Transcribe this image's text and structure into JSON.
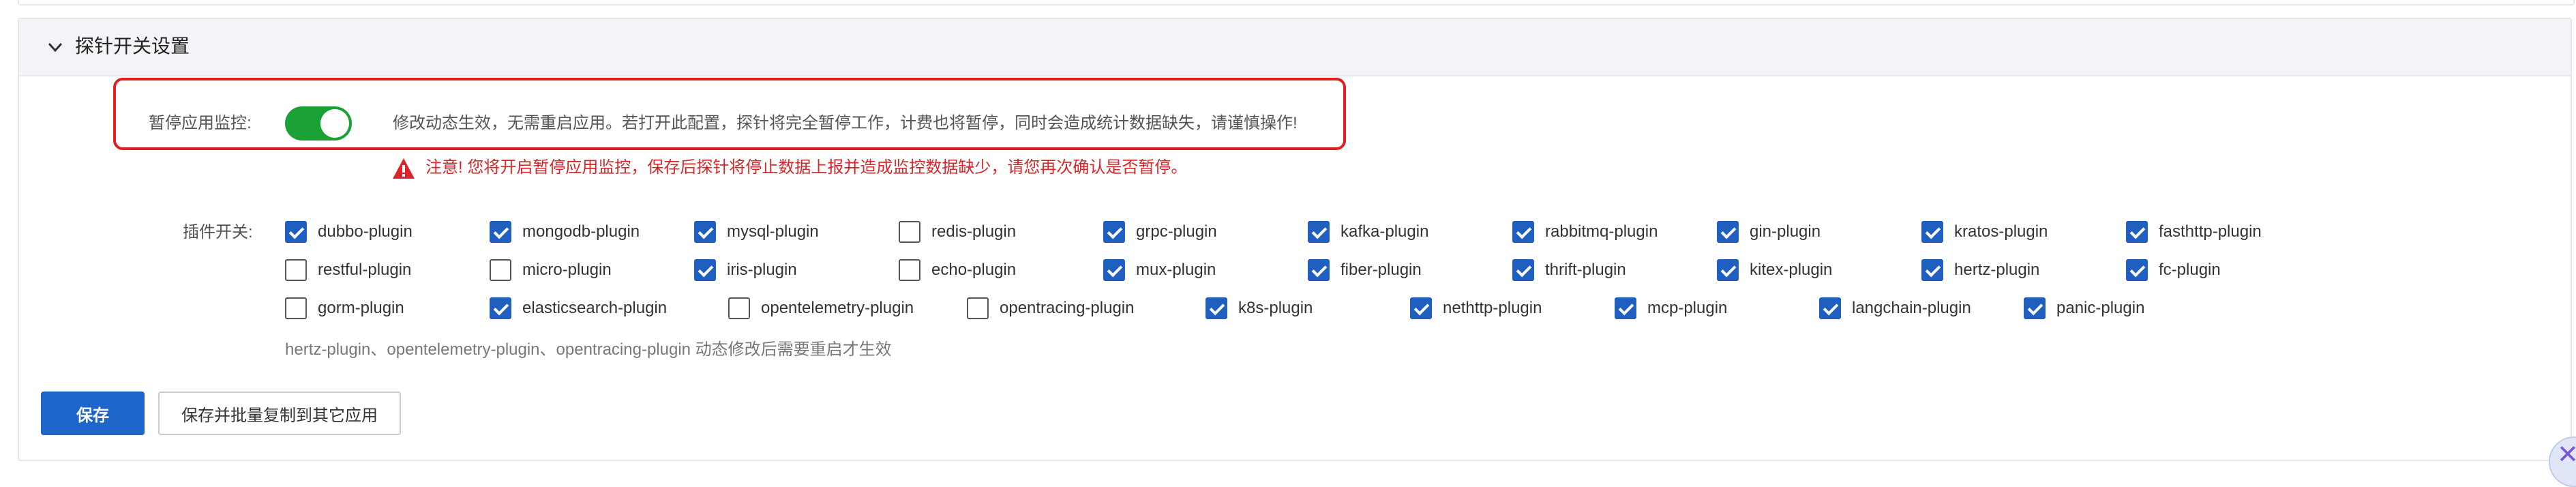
{
  "section": {
    "title": "探针开关设置",
    "expanded": true
  },
  "pause": {
    "label": "暂停应用监控:",
    "enabled": true,
    "hint": "修改动态生效，无需重启应用。若打开此配置，探针将完全暂停工作，计费也将暂停，同时会造成统计数据缺失，请谨慎操作!",
    "warning": "注意! 您将开启暂停应用监控，保存后探针将停止数据上报并造成监控数据缺少，请您再次确认是否暂停。"
  },
  "plugins": {
    "label": "插件开关:",
    "rows": [
      [
        {
          "name": "dubbo-plugin",
          "checked": true
        },
        {
          "name": "mongodb-plugin",
          "checked": true
        },
        {
          "name": "mysql-plugin",
          "checked": true
        },
        {
          "name": "redis-plugin",
          "checked": false
        },
        {
          "name": "grpc-plugin",
          "checked": true
        },
        {
          "name": "kafka-plugin",
          "checked": true
        },
        {
          "name": "rabbitmq-plugin",
          "checked": true
        },
        {
          "name": "gin-plugin",
          "checked": true
        },
        {
          "name": "kratos-plugin",
          "checked": true
        },
        {
          "name": "fasthttp-plugin",
          "checked": true
        }
      ],
      [
        {
          "name": "restful-plugin",
          "checked": false
        },
        {
          "name": "micro-plugin",
          "checked": false
        },
        {
          "name": "iris-plugin",
          "checked": true
        },
        {
          "name": "echo-plugin",
          "checked": false
        },
        {
          "name": "mux-plugin",
          "checked": true
        },
        {
          "name": "fiber-plugin",
          "checked": true
        },
        {
          "name": "thrift-plugin",
          "checked": true
        },
        {
          "name": "kitex-plugin",
          "checked": true
        },
        {
          "name": "hertz-plugin",
          "checked": true
        },
        {
          "name": "fc-plugin",
          "checked": true
        }
      ],
      [
        {
          "name": "gorm-plugin",
          "checked": false
        },
        {
          "name": "elasticsearch-plugin",
          "checked": true
        },
        {
          "name": "opentelemetry-plugin",
          "checked": false
        },
        {
          "name": "opentracing-plugin",
          "checked": false
        },
        {
          "name": "k8s-plugin",
          "checked": true
        },
        {
          "name": "nethttp-plugin",
          "checked": true
        },
        {
          "name": "mcp-plugin",
          "checked": true
        },
        {
          "name": "langchain-plugin",
          "checked": true
        },
        {
          "name": "panic-plugin",
          "checked": true
        }
      ]
    ],
    "note": "hertz-plugin、opentelemetry-plugin、opentracing-plugin 动态修改后需要重启才生效"
  },
  "actions": {
    "save": "保存",
    "save_copy": "保存并批量复制到其它应用"
  },
  "colors": {
    "primary": "#1d65c8",
    "toggle_on": "#1aa034",
    "warning": "#d8262a",
    "highlight_border": "#e02020"
  }
}
